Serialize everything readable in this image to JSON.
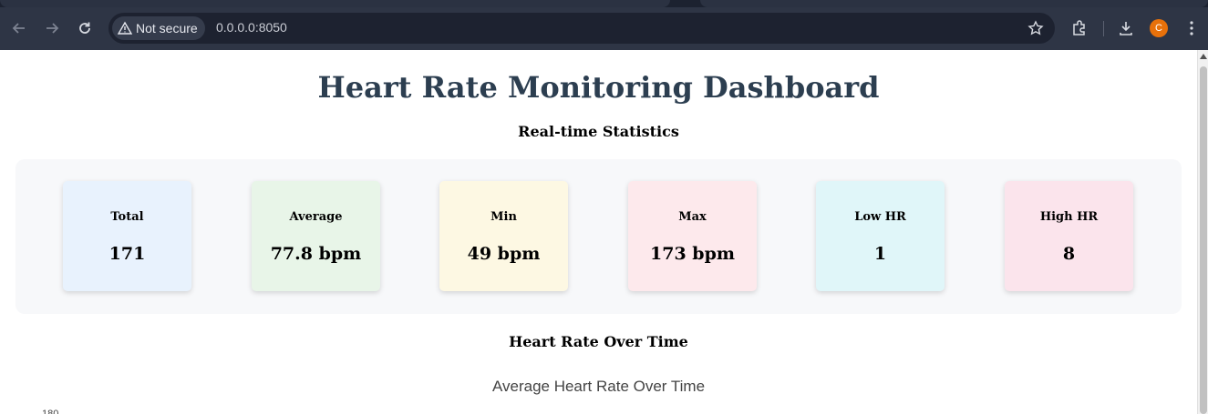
{
  "browser": {
    "security_label": "Not secure",
    "url": "0.0.0.0:8050",
    "avatar_initial": "C",
    "icons": [
      "back-icon",
      "forward-icon",
      "reload-icon",
      "warning-icon",
      "star-icon",
      "extensions-icon",
      "download-icon",
      "more-vert-icon"
    ],
    "avatar_color": "#e8710a"
  },
  "page": {
    "title": "Heart Rate Monitoring Dashboard",
    "stats_heading": "Real-time Statistics",
    "chart_section_heading": "Heart Rate Over Time",
    "title_color": "#2c3e50"
  },
  "stats": [
    {
      "label": "Total",
      "value": "171",
      "color": "#e8f2fd"
    },
    {
      "label": "Average",
      "value": "77.8 bpm",
      "color": "#e8f5e8"
    },
    {
      "label": "Min",
      "value": "49 bpm",
      "color": "#fdf8e3"
    },
    {
      "label": "Max",
      "value": "173 bpm",
      "color": "#fde9ec"
    },
    {
      "label": "Low HR",
      "value": "1",
      "color": "#e0f6f9"
    },
    {
      "label": "High HR",
      "value": "8",
      "color": "#fbe4ec"
    }
  ],
  "chart": {
    "title": "Average Heart Rate Over Time",
    "visible_y_tick": "180"
  }
}
